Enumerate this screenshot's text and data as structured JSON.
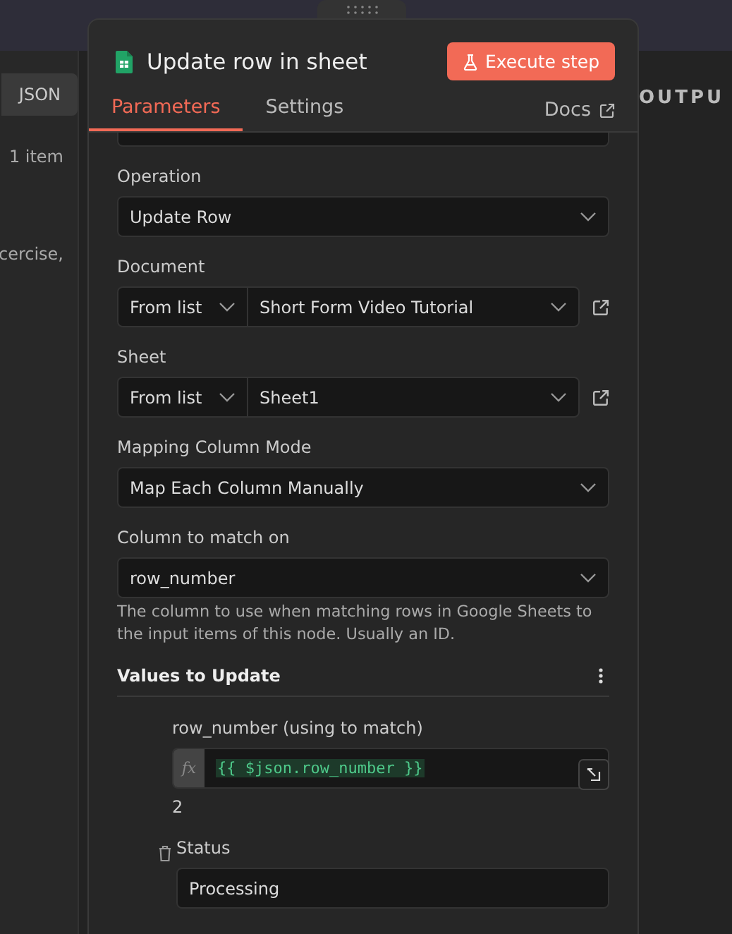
{
  "background": {
    "left_panel": {
      "button": "JSON",
      "count": "1 item",
      "text_fragment": "cercise,"
    },
    "right_panel": {
      "heading": "OUTPU"
    }
  },
  "modal": {
    "title": "Update row in sheet",
    "execute_button": "Execute step",
    "tabs": [
      {
        "label": "Parameters",
        "selected": true
      },
      {
        "label": "Settings",
        "selected": false
      }
    ],
    "docs_link": "Docs",
    "fields": [
      {
        "kind": "select",
        "label": "Operation",
        "value": "Update Row"
      },
      {
        "kind": "locator",
        "label": "Document",
        "mode": "From list",
        "value": "Short Form Video Tutorial"
      },
      {
        "kind": "locator",
        "label": "Sheet",
        "mode": "From list",
        "value": "Sheet1"
      },
      {
        "kind": "select",
        "label": "Mapping Column Mode",
        "value": "Map Each Column Manually"
      },
      {
        "kind": "select",
        "label": "Column to match on",
        "value": "row_number",
        "hint": "The column to use when matching rows in Google Sheets to the input items of this node. Usually an ID."
      }
    ],
    "values_section": {
      "title": "Values to Update",
      "items": [
        {
          "kind": "expression",
          "label": "row_number (using to match)",
          "prefix": "fx",
          "value": "{{ $json.row_number }}",
          "result": "2",
          "deletable": false
        },
        {
          "kind": "text",
          "label": "Status",
          "value": "Processing",
          "deletable": true
        }
      ]
    }
  }
}
